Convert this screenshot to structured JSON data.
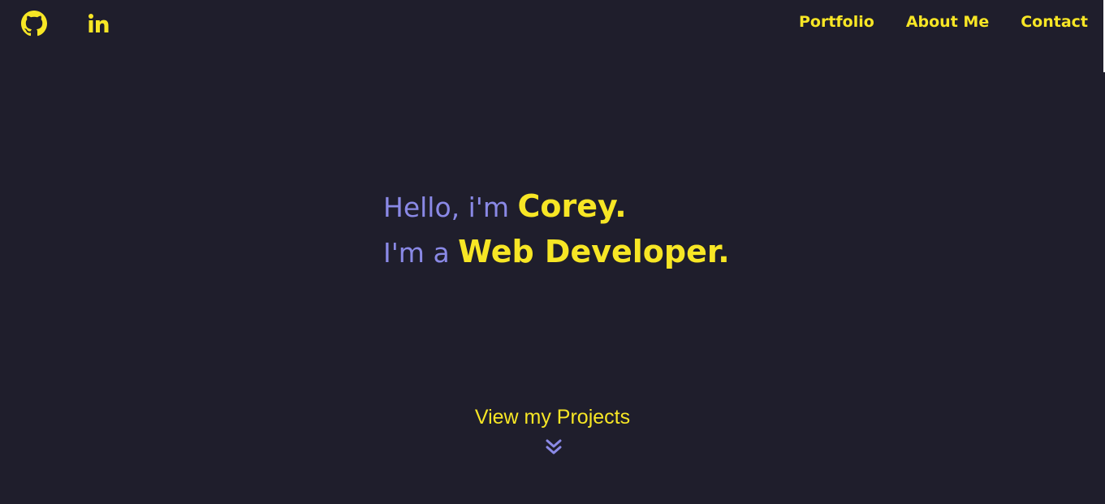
{
  "social": {
    "github_icon": "github-icon",
    "linkedin_icon": "linkedin-icon"
  },
  "nav": {
    "items": [
      {
        "label": "Portfolio"
      },
      {
        "label": "About Me"
      },
      {
        "label": "Contact"
      }
    ]
  },
  "hero": {
    "line1_prefix": "Hello, i'm ",
    "line1_highlight": "Corey.",
    "line2_prefix": "I'm a ",
    "line2_highlight": "Web Developer."
  },
  "cta": {
    "label": "View my Projects",
    "icon": "double-chevron-down-icon"
  },
  "colors": {
    "background": "#1f1e2c",
    "accent_yellow": "#f7e625",
    "accent_purple": "#8a89e6"
  }
}
